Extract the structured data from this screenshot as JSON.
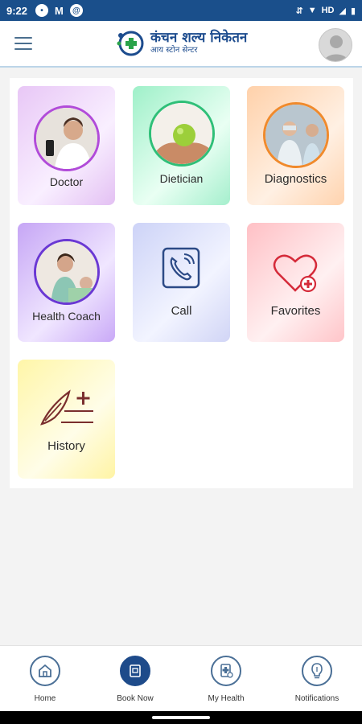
{
  "status": {
    "time": "9:22",
    "network": "HD"
  },
  "header": {
    "logo_title": "कंचन शल्य निकेतन",
    "logo_subtitle": "आय स्टोन सेन्टर"
  },
  "tiles": [
    {
      "label": "Doctor"
    },
    {
      "label": "Dietician"
    },
    {
      "label": "Diagnostics"
    },
    {
      "label": "Health Coach"
    },
    {
      "label": "Call"
    },
    {
      "label": "Favorites"
    },
    {
      "label": "History"
    }
  ],
  "nav": [
    {
      "label": "Home"
    },
    {
      "label": "Book Now"
    },
    {
      "label": "My Health"
    },
    {
      "label": "Notifications"
    }
  ],
  "colors": {
    "brand": "#1d4c8e",
    "statusbar": "#1a4f8b"
  }
}
